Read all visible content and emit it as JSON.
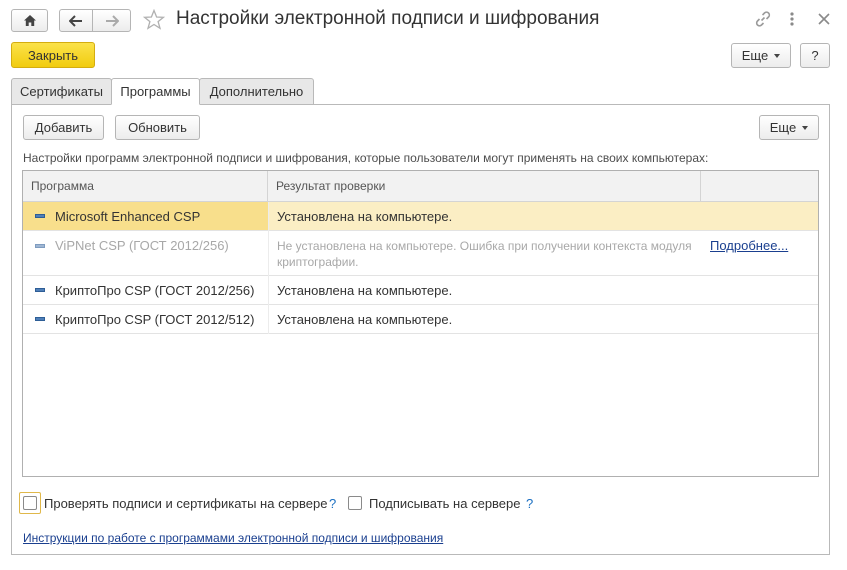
{
  "window": {
    "title": "Настройки электронной подписи и шифрования"
  },
  "toolbar": {
    "close_label": "Закрыть",
    "more_label": "Еще",
    "help_label": "?"
  },
  "tabs": [
    {
      "label": "Сертификаты",
      "active": false
    },
    {
      "label": "Программы",
      "active": true
    },
    {
      "label": "Дополнительно",
      "active": false
    }
  ],
  "panel": {
    "add_label": "Добавить",
    "refresh_label": "Обновить",
    "more_label": "Еще",
    "description": "Настройки программ электронной подписи и шифрования, которые пользователи могут применять на своих компьютерах:"
  },
  "grid": {
    "columns": [
      "Программа",
      "Результат проверки",
      ""
    ],
    "rows": [
      {
        "program": "Microsoft Enhanced CSP",
        "result": "Установлена на компьютере.",
        "details": "",
        "selected": true,
        "disabled": false
      },
      {
        "program": "ViPNet CSP (ГОСТ 2012/256)",
        "result": "Не установлена на компьютере. Ошибка при получении контекста модуля криптографии.",
        "details": "Подробнее...",
        "selected": false,
        "disabled": true
      },
      {
        "program": "КриптоПро CSP (ГОСТ 2012/256)",
        "result": "Установлена на компьютере.",
        "details": "",
        "selected": false,
        "disabled": false
      },
      {
        "program": "КриптоПро CSP (ГОСТ 2012/512)",
        "result": "Установлена на компьютере.",
        "details": "",
        "selected": false,
        "disabled": false
      }
    ]
  },
  "options": {
    "verify_on_server_label": "Проверять подписи и сертификаты на сервере",
    "verify_on_server_checked": false,
    "sign_on_server_label": "Подписывать на сервере",
    "sign_on_server_checked": false,
    "help_mark": "?"
  },
  "footer": {
    "instructions_link": "Инструкции по работе с программами электронной подписи и шифрования"
  },
  "icons": {
    "home": "home-icon",
    "back": "arrow-left-icon",
    "forward": "arrow-right-icon",
    "favorite": "star-icon",
    "link": "link-icon",
    "menu": "kebab-menu-icon",
    "close": "close-icon",
    "program": "program-icon"
  },
  "colors": {
    "accent_button": "#f5d316",
    "selected_row": "#fbeec4",
    "selected_cell": "#f8df8c",
    "link": "#1a3f8f"
  }
}
